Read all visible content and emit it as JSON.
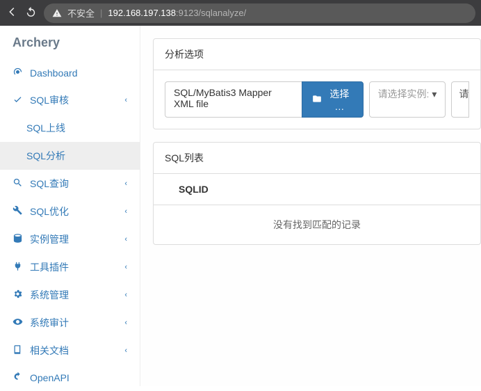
{
  "browser": {
    "insecure_label": "不安全",
    "url_host": "192.168.197.138",
    "url_port_path": ":9123/sqlanalyze/"
  },
  "brand": "Archery",
  "menu": {
    "dashboard": "Dashboard",
    "sql_review": "SQL审核",
    "sql_online": "SQL上线",
    "sql_analyze": "SQL分析",
    "sql_query": "SQL查询",
    "sql_optimize": "SQL优化",
    "instance_mgmt": "实例管理",
    "plugins": "工具插件",
    "system_mgmt": "系统管理",
    "system_audit": "系统审计",
    "docs": "相关文档",
    "openapi": "OpenAPI"
  },
  "panel1": {
    "title": "分析选项",
    "file_label": "SQL/MyBatis3 Mapper XML file",
    "choose_btn": "选择 …",
    "instance_placeholder": "请选择实例:",
    "db_placeholder_cut": "请"
  },
  "panel2": {
    "title": "SQL列表",
    "col_sqlid": "SQLID",
    "empty": "没有找到匹配的记录"
  }
}
